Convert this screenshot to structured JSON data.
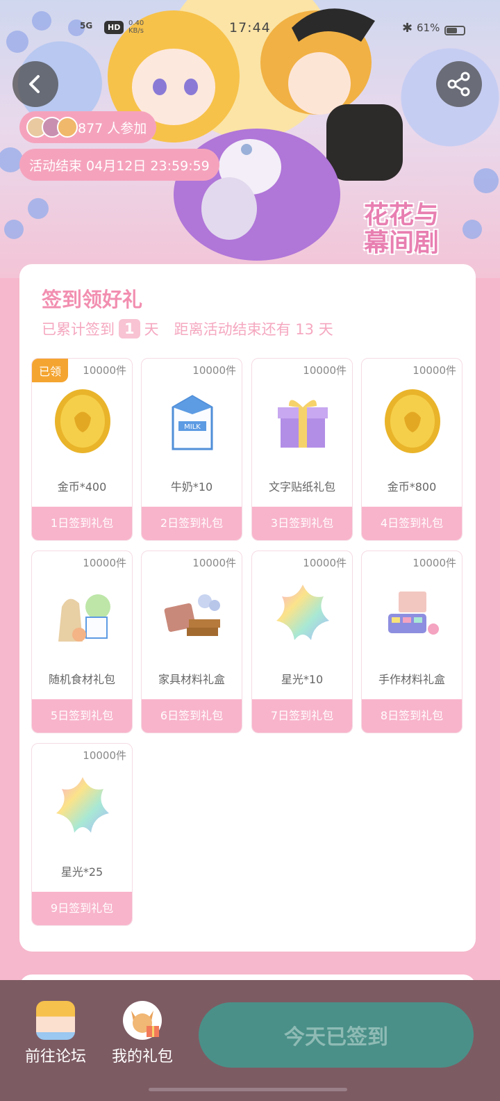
{
  "status_bar": {
    "network": "5G",
    "hd": "HD",
    "speed_value": "0.40",
    "speed_unit": "KB/s",
    "time": "17:44",
    "battery": "61%",
    "battery_level": 0.61
  },
  "hero": {
    "participants": "877 人参加",
    "end_time": "活动结束 04月12日 23:59:59",
    "logo_line1": "花花与",
    "logo_line2": "幕间剧"
  },
  "signin": {
    "title": "签到领好礼",
    "accum_prefix": "已累计签到",
    "accum_days": "1",
    "accum_suffix": "天",
    "remaining": "距离活动结束还有 13 天"
  },
  "rewards": [
    {
      "qty": "10000件",
      "name": "金币*400",
      "day": "1日签到礼包",
      "claimed": "已领",
      "icon": "gold-coin-icon"
    },
    {
      "qty": "10000件",
      "name": "牛奶*10",
      "day": "2日签到礼包",
      "icon": "milk-carton-icon"
    },
    {
      "qty": "10000件",
      "name": "文字贴纸礼包",
      "day": "3日签到礼包",
      "icon": "gift-box-icon"
    },
    {
      "qty": "10000件",
      "name": "金币*800",
      "day": "4日签到礼包",
      "icon": "gold-coin-icon"
    },
    {
      "qty": "10000件",
      "name": "随机食材礼包",
      "day": "5日签到礼包",
      "icon": "food-bag-icon"
    },
    {
      "qty": "10000件",
      "name": "家具材料礼盒",
      "day": "6日签到礼包",
      "icon": "furniture-material-icon"
    },
    {
      "qty": "10000件",
      "name": "星光*10",
      "day": "7日签到礼包",
      "icon": "rainbow-star-icon"
    },
    {
      "qty": "10000件",
      "name": "手作材料礼盒",
      "day": "8日签到礼包",
      "icon": "craft-material-icon"
    },
    {
      "qty": "10000件",
      "name": "星光*25",
      "day": "9日签到礼包",
      "icon": "rainbow-star-icon"
    }
  ],
  "bottom": {
    "forum": "前往论坛",
    "gifts": "我的礼包",
    "checkin": "今天已签到"
  },
  "colors": {
    "page_bg": "#f6b8cc",
    "accent_pink": "#f28fb0",
    "day_label_bg": "#f8b4cb",
    "claimed_badge": "#f4a531",
    "bottom_bar": "#7d5b63",
    "checkin_btn": "#4a9088"
  }
}
